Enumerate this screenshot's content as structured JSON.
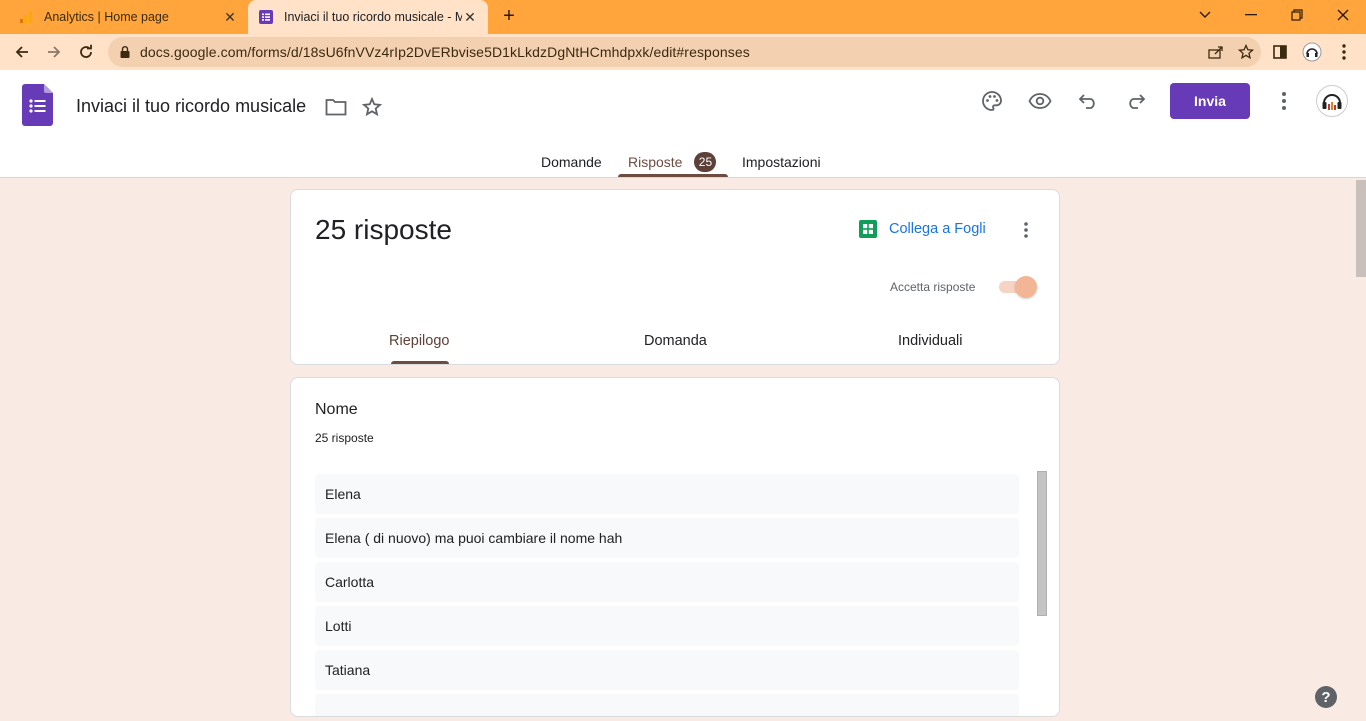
{
  "browser": {
    "tabs": [
      {
        "title": "Analytics | Home page",
        "close": "✕"
      },
      {
        "title": "Inviaci il tuo ricordo musicale - Moduli Google",
        "close": "✕"
      }
    ],
    "new_tab": "+",
    "url": "docs.google.com/forms/d/18sU6fnVVz4rIp2DvERbvise5D1kLkdzDgNtHCmhdpxk/edit#responses"
  },
  "header": {
    "form_title": "Inviaci il tuo ricordo musicale",
    "send_label": "Invia",
    "tabs": [
      {
        "label": "Domande"
      },
      {
        "label": "Risposte",
        "badge": "25"
      },
      {
        "label": "Impostazioni"
      }
    ]
  },
  "responses": {
    "count_label": "25 risposte",
    "sheets_link": "Collega a Fogli",
    "accept_label": "Accetta risposte",
    "accept_on": true,
    "subtabs": [
      "Riepilogo",
      "Domanda",
      "Individuali"
    ]
  },
  "question": {
    "title": "Nome",
    "count": "25 risposte",
    "answers": [
      "Elena",
      "Elena ( di nuovo) ma puoi cambiare il nome hah",
      "Carlotta",
      "Lotti",
      "Tatiana"
    ]
  },
  "help_glyph": "?",
  "colors": {
    "accent_purple": "#673ab7",
    "tab_accent": "#6d4c41",
    "page_bg": "#f9ebe3",
    "browser_tab_bar": "#ffa53c",
    "link_blue": "#1a73e8"
  }
}
